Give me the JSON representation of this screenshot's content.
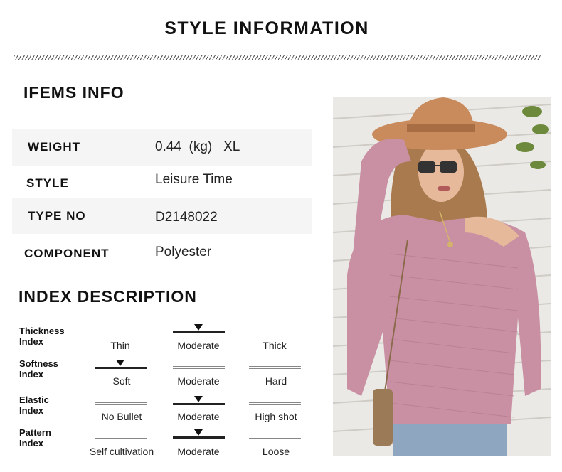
{
  "header": {
    "title": "STYLE INFORMATION"
  },
  "items_info": {
    "title": "IFEMS INFO",
    "rows": [
      {
        "label": "WEIGHT",
        "value": "0.44  (kg)   XL"
      },
      {
        "label": "STYLE",
        "value": "Leisure Time"
      },
      {
        "label": "TYPE NO",
        "value": "D2148022"
      },
      {
        "label": "COMPONENT",
        "value": "Polyester"
      }
    ]
  },
  "index_description": {
    "title": "INDEX DESCRIPTION",
    "rows": [
      {
        "label_line1": "Thickness",
        "label_line2": "Index",
        "options": [
          "Thin",
          "Moderate",
          "Thick"
        ],
        "selected": 1
      },
      {
        "label_line1": "Softness",
        "label_line2": "Index",
        "options": [
          "Soft",
          "Moderate",
          "Hard"
        ],
        "selected": 0
      },
      {
        "label_line1": "Elastic",
        "label_line2": "Index",
        "options": [
          "No Bullet",
          "Moderate",
          "High shot"
        ],
        "selected": 1
      },
      {
        "label_line1": "Pattern",
        "label_line2": "Index",
        "options": [
          "Self cultivation",
          "Moderate",
          "Loose"
        ],
        "selected": 1
      }
    ]
  },
  "product_photo": {
    "icon": "model-photo",
    "colors": {
      "sweater": "#c98fa3",
      "hat": "#c98a5c",
      "background": "#e8e6e2",
      "jeans": "#8fa6c0"
    }
  }
}
